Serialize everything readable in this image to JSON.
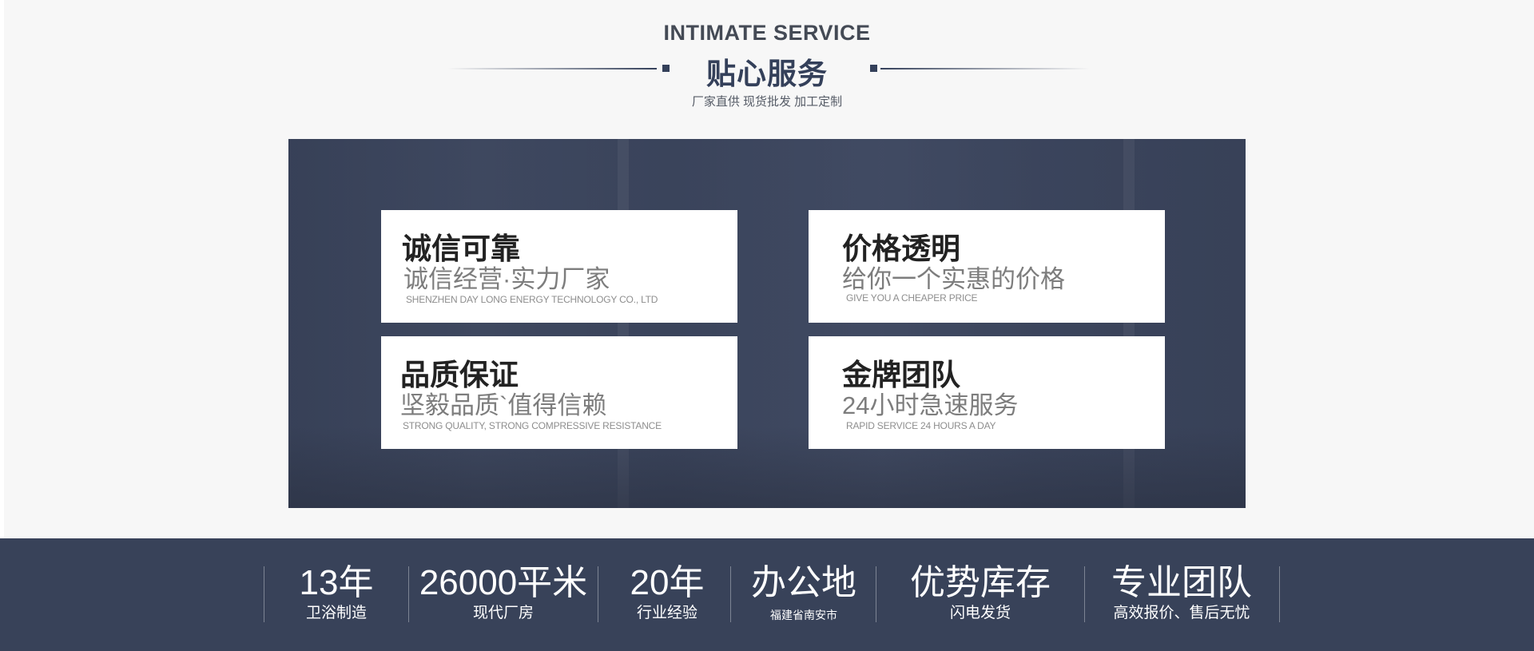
{
  "header": {
    "title_en": "INTIMATE SERVICE",
    "title_cn": "贴心服务",
    "subtitle": "厂家直供 现货批发 加工定制"
  },
  "cards": [
    {
      "title": "诚信可靠",
      "sub": "诚信经营·实力厂家",
      "en": "SHENZHEN DAY LONG ENERGY TECHNOLOGY CO., LTD"
    },
    {
      "title": "价格透明",
      "sub": "给你一个实惠的价格",
      "en": "GIVE YOU A CHEAPER PRICE"
    },
    {
      "title": "品质保证",
      "sub": "坚毅品质`值得信赖",
      "en": "STRONG QUALITY, STRONG COMPRESSIVE RESISTANCE"
    },
    {
      "title": "金牌团队",
      "sub": "24小时急速服务",
      "en": "RAPID SERVICE 24 HOURS A DAY"
    }
  ],
  "stats": [
    {
      "value": "13年",
      "label": "卫浴制造"
    },
    {
      "value": "26000平米",
      "label": "现代厂房"
    },
    {
      "value": "20年",
      "label": "行业经验"
    },
    {
      "value": "办公地",
      "label": "福建省南安市"
    },
    {
      "value": "优势库存",
      "label": "闪电发货"
    },
    {
      "value": "专业团队",
      "label": "高效报价、售后无忧"
    }
  ],
  "colors": {
    "accent": "#34405a",
    "stats_background": "#384259",
    "page_background": "#f7f7f7"
  }
}
